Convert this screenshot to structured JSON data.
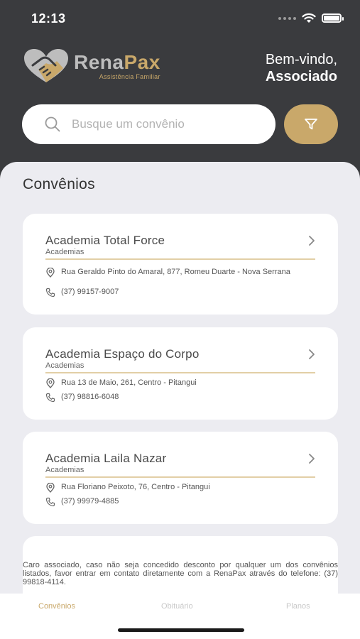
{
  "status": {
    "time": "12:13"
  },
  "brand": {
    "name_part1": "Rena",
    "name_part2": "Pax",
    "subtitle": "Assistência Familiar"
  },
  "welcome": {
    "line1": "Bem-vindo,",
    "line2": "Associado"
  },
  "search": {
    "placeholder": "Busque um convênio"
  },
  "section": {
    "title": "Convênios"
  },
  "cards": [
    {
      "name": "Academia Total Force",
      "category": "Academias",
      "address": "Rua Geraldo Pinto do Amaral, 877, Romeu Duarte - Nova Serrana",
      "phone": "(37) 99157-9007"
    },
    {
      "name": "Academia Espaço do Corpo",
      "category": "Academias",
      "address": "Rua 13 de Maio, 261, Centro - Pitangui",
      "phone": "(37) 98816-6048"
    },
    {
      "name": "Academia Laila Nazar",
      "category": "Academias",
      "address": "Rua Floriano Peixoto, 76, Centro - Pitangui",
      "phone": "(37) 99979-4885"
    }
  ],
  "disclaimer": "Caro associado, caso não seja concedido desconto por qualquer um dos convênios listados, favor entrar em contato diretamente com a RenaPax através do telefone: (37) 99818-4114.",
  "tabs": [
    {
      "label": "Convênios",
      "active": true
    },
    {
      "label": "Obituário",
      "active": false
    },
    {
      "label": "Planos",
      "active": false
    }
  ],
  "colors": {
    "header_bg": "#3a3b3e",
    "accent": "#c9a86a",
    "page_bg": "#ececf1"
  },
  "icons": {
    "search": "search-icon",
    "filter": "filter-icon",
    "chevron": "chevron-right-icon",
    "location": "location-pin-icon",
    "phone": "phone-icon",
    "logo": "handshake-heart-logo"
  }
}
